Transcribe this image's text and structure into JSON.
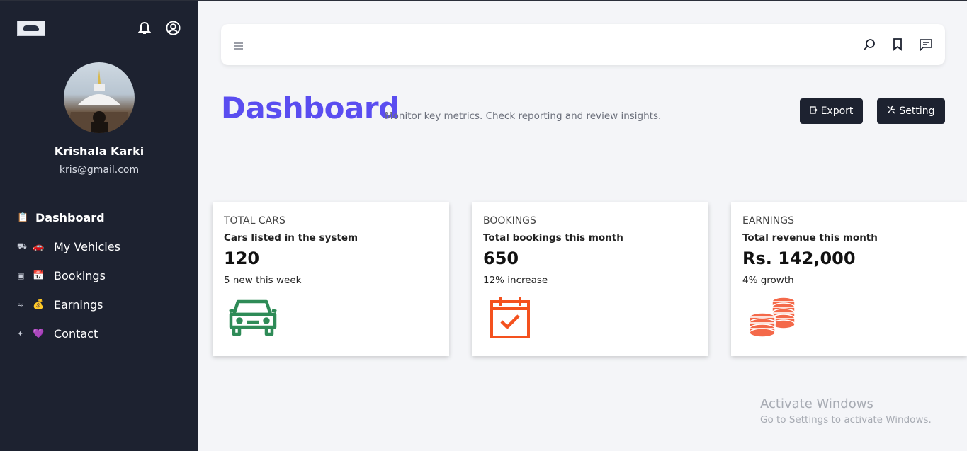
{
  "sidebar": {
    "user": {
      "name": "Krishala Karki",
      "email": "kris@gmail.com"
    },
    "icons": [
      "bell-icon",
      "user-circle-icon"
    ],
    "items": [
      {
        "label": "Dashboard",
        "emoji": "📋",
        "active": true
      },
      {
        "label": "My Vehicles",
        "emoji": "🚗",
        "lead": "⛟"
      },
      {
        "label": "Bookings",
        "emoji": "📅",
        "lead": "▣"
      },
      {
        "label": "Earnings",
        "emoji": "💰",
        "lead": "≈"
      },
      {
        "label": "Contact",
        "emoji": "💜",
        "lead": "✦"
      }
    ]
  },
  "topbar": {
    "icons": [
      "menu-icon",
      "search-icon",
      "bookmark-icon",
      "message-icon"
    ]
  },
  "header": {
    "title": "Dashboard",
    "subtitle": "Monitor key metrics. Check reporting and review insights.",
    "export_label": "Export",
    "setting_label": "Setting"
  },
  "cards": [
    {
      "title": "TOTAL CARS",
      "subtitle": "Cars listed in the system",
      "value": "120",
      "note": "5 new this week",
      "icon": "car-icon",
      "color": "#2e8b57"
    },
    {
      "title": "BOOKINGS",
      "subtitle": "Total bookings this month",
      "value": "650",
      "note": "12% increase",
      "icon": "calendar-check-icon",
      "color": "#f4511e"
    },
    {
      "title": "EARNINGS",
      "subtitle": "Total revenue this month",
      "value": "Rs. 142,000",
      "note": "4% growth",
      "icon": "coins-icon",
      "color": "#f4694a"
    }
  ],
  "watermark": {
    "line1": "Activate Windows",
    "line2": "Go to Settings to activate Windows."
  },
  "colors": {
    "sidebar_bg": "#1d2230",
    "accent": "#5a4df0",
    "page_bg": "#f4f5f8"
  }
}
